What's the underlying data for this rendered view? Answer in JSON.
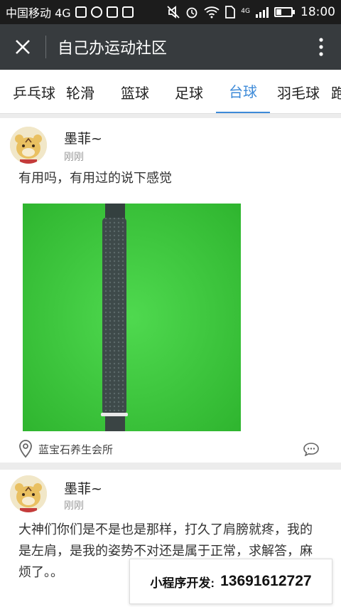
{
  "status_bar": {
    "carrier": "中国移动 4G",
    "network": "4G",
    "time": "18:00"
  },
  "titlebar": {
    "title": "自己办运动社区",
    "close_icon": "close-icon",
    "more_icon": "more-vertical-icon"
  },
  "tabs": [
    {
      "label": "乒乓球",
      "active": false
    },
    {
      "label": "轮滑",
      "active": false
    },
    {
      "label": "篮球",
      "active": false
    },
    {
      "label": "足球",
      "active": false
    },
    {
      "label": "台球",
      "active": true
    },
    {
      "label": "羽毛球",
      "active": false
    },
    {
      "label": "跑",
      "active": false
    }
  ],
  "posts": [
    {
      "author": "墨菲~",
      "time": "刚刚",
      "text": "有用吗，有用过的说下感觉",
      "location": "蓝宝石养生会所"
    },
    {
      "author": "墨菲~",
      "time": "刚刚",
      "text": "大神们你们是不是也是那样，打久了肩膀就疼，我的是左肩，是我的姿势不对还是属于正常，求解答，麻烦了。。"
    }
  ],
  "promo": {
    "label": "小程序开发:",
    "phone": "13691612727"
  },
  "colors": {
    "statusbar": "#1c1c1c",
    "titlebar": "#373b3e",
    "tab_active": "#3d8ad8",
    "photo_bg": "#3dcc3d"
  }
}
